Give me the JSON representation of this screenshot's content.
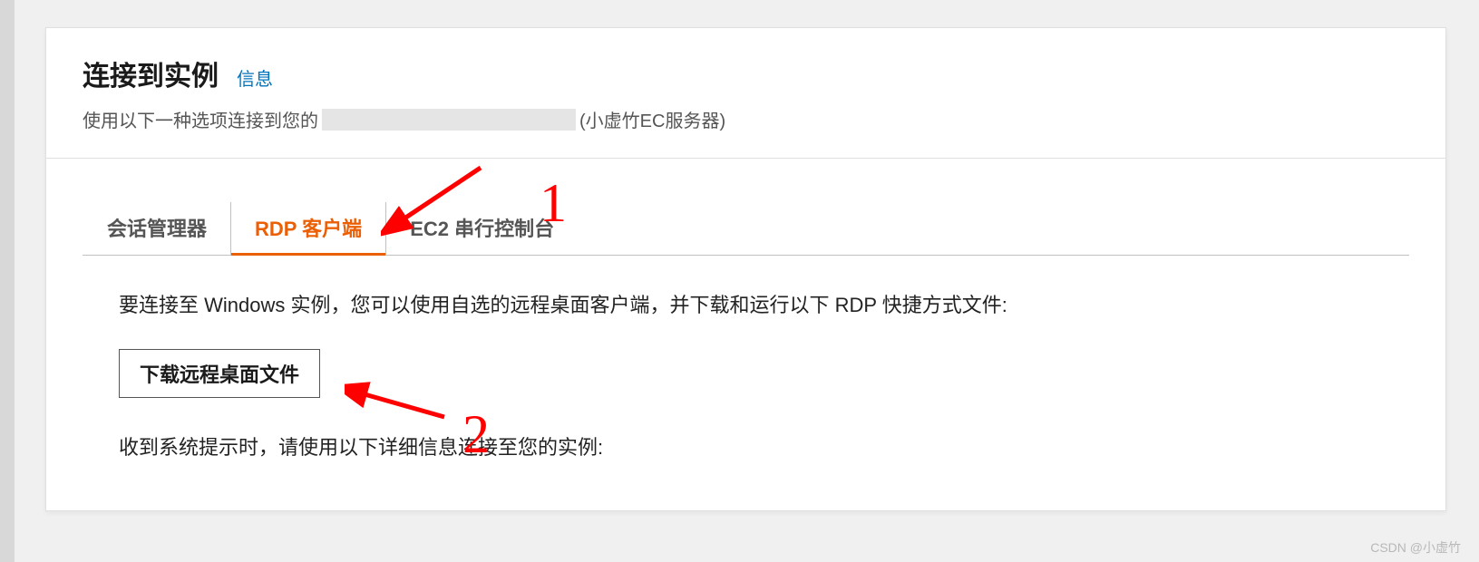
{
  "header": {
    "title": "连接到实例",
    "info_link": "信息",
    "subtitle_prefix": "使用以下一种选项连接到您的",
    "subtitle_suffix": "(小虚竹EC服务器)"
  },
  "tabs": {
    "session_manager": "会话管理器",
    "rdp_client": "RDP 客户端",
    "serial_console": "EC2 串行控制台"
  },
  "content": {
    "instructions": "要连接至 Windows 实例，您可以使用自选的远程桌面客户端，并下载和运行以下 RDP 快捷方式文件:",
    "download_button": "下载远程桌面文件",
    "prompt_line": "收到系统提示时，请使用以下详细信息连接至您的实例:"
  },
  "annotations": {
    "num1": "1",
    "num2": "2"
  },
  "watermark": "CSDN @小虚竹"
}
